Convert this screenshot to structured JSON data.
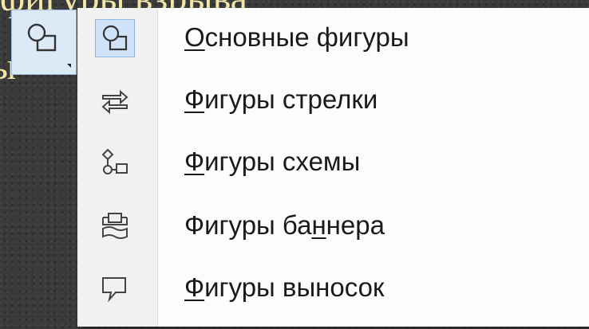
{
  "background_text": {
    "line1": "фигуры взрыва",
    "line2": "ы"
  },
  "ribbon": {
    "button_icon": "shapes-icon"
  },
  "menu": {
    "items": [
      {
        "label": "Основные фигуры",
        "mnemonic_index": 0,
        "icon": "basic-shapes-icon",
        "selected": true
      },
      {
        "label": "Фигуры стрелки",
        "mnemonic_index": 0,
        "icon": "arrow-shapes-icon",
        "selected": false
      },
      {
        "label": "Фигуры схемы",
        "mnemonic_index": 0,
        "icon": "flowchart-shapes-icon",
        "selected": false
      },
      {
        "label": "Фигуры баннера",
        "mnemonic_index": 9,
        "icon": "banner-shapes-icon",
        "selected": false
      },
      {
        "label": "Фигуры выносок",
        "mnemonic_index": 0,
        "icon": "callout-shapes-icon",
        "selected": false
      }
    ]
  },
  "colors": {
    "accent_highlight": "#cfe2f7",
    "accent_border": "#8fb6e3",
    "background_text": "#f2e6a8"
  }
}
